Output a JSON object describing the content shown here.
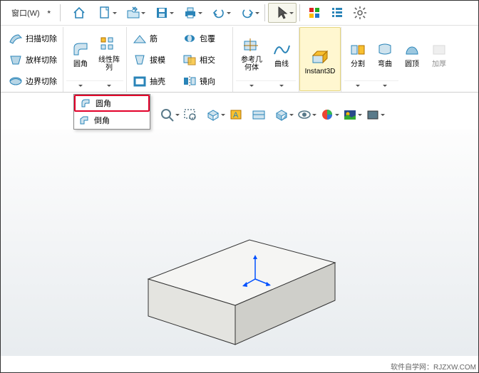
{
  "menubar": {
    "window": "窗口(W)"
  },
  "ribbon": {
    "col1": [
      {
        "label": "扫描切除"
      },
      {
        "label": "放样切除"
      },
      {
        "label": "边界切除"
      }
    ],
    "grp2": [
      {
        "label": "圆角"
      },
      {
        "label": "线性阵\n列"
      }
    ],
    "grp3_top": [
      {
        "label": "筋"
      },
      {
        "label": "包覆"
      }
    ],
    "grp3_mid": [
      {
        "label": "拔模"
      },
      {
        "label": "相交"
      }
    ],
    "grp3_bot": [
      {
        "label": "抽壳"
      },
      {
        "label": "镜向"
      }
    ],
    "grp4": [
      {
        "label": "参考几\n何体"
      },
      {
        "label": "曲线"
      }
    ],
    "instant": {
      "label": "Instant3D"
    },
    "grp5": [
      {
        "label": "分割"
      },
      {
        "label": "弯曲"
      },
      {
        "label": "圆顶"
      },
      {
        "label": "加厚"
      }
    ]
  },
  "popup": {
    "item1": "圆角",
    "item2": "倒角"
  },
  "footer": "软件自学网：RJZXW.COM"
}
